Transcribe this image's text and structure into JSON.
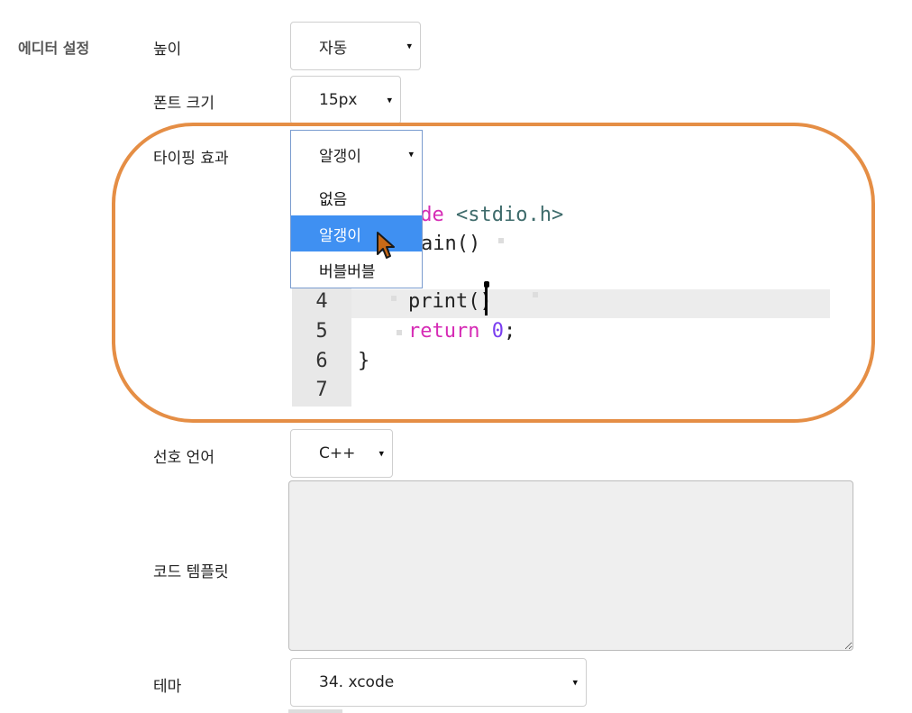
{
  "section": {
    "label": "에디터 설정"
  },
  "rows": {
    "height": {
      "label": "높이",
      "value": "자동"
    },
    "font_size": {
      "label": "폰트 크기",
      "value": "15px"
    },
    "typing_effect": {
      "label": "타이핑 효과",
      "value": "알갱이",
      "options": [
        "없음",
        "알갱이",
        "버블버블"
      ],
      "selected_index": 1
    },
    "language": {
      "label": "선호 언어",
      "value": "C++"
    },
    "code_template": {
      "label": "코드 템플릿",
      "value": ""
    },
    "theme": {
      "label": "테마",
      "value": "34. xcode"
    }
  },
  "preview": {
    "line_numbers": [
      "4",
      "5",
      "6",
      "7"
    ],
    "lines": {
      "include_kw": "ude",
      "include_str": "<stdio.h>",
      "main_fragment": "ain()",
      "print": "print()",
      "return_kw": "return",
      "return_num": "0",
      "return_semi": ";",
      "close_brace": "}"
    }
  },
  "caret_glyph": "▾",
  "colors": {
    "highlight_oval": "#e58e45",
    "selected_option": "#3f90f2",
    "keyword": "#d62bb5",
    "string": "#3e6b6b",
    "number": "#7a3df0"
  }
}
